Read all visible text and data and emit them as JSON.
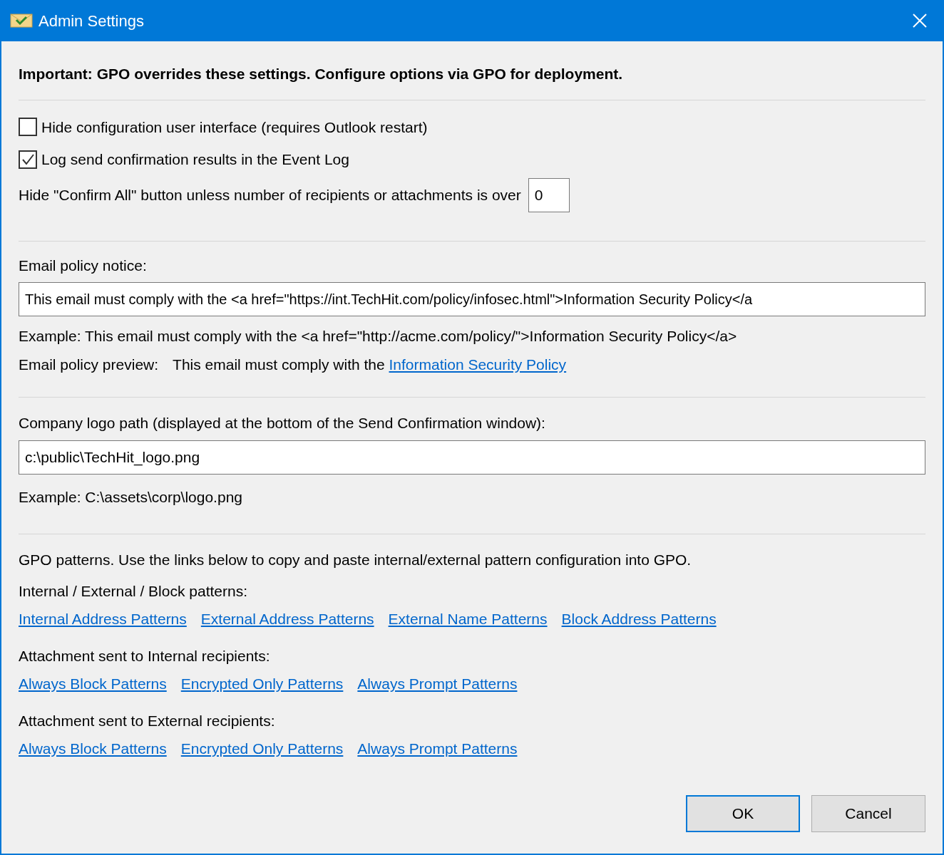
{
  "window": {
    "title": "Admin Settings"
  },
  "notice": "Important: GPO overrides these settings. Configure options via GPO for deployment.",
  "checkboxes": [
    {
      "label": "Hide configuration user interface (requires Outlook restart)",
      "checked": false
    },
    {
      "label": "Log send confirmation results in the Event Log",
      "checked": true
    }
  ],
  "confirm_all": {
    "label": "Hide \"Confirm All\" button unless number of recipients or attachments is over",
    "value": "0"
  },
  "policy": {
    "label": "Email policy notice:",
    "value": "This email must comply with the <a href=\"https://int.TechHit.com/policy/infosec.html\">Information Security Policy</a",
    "example": "Example: This email must comply with the <a href=\"http://acme.com/policy/\">Information Security Policy</a>",
    "preview_label": "Email policy preview:",
    "preview_text": "This email must comply with the",
    "preview_link": "Information Security Policy"
  },
  "logo": {
    "label": "Company logo path (displayed at the bottom of the Send Confirmation window):",
    "value": "c:\\public\\TechHit_logo.png",
    "example": "Example: C:\\assets\\corp\\logo.png"
  },
  "gpo": {
    "intro": "GPO patterns. Use the links below to copy and paste internal/external pattern configuration into GPO.",
    "groups": [
      {
        "label": "Internal / External / Block patterns:",
        "links": [
          "Internal Address Patterns",
          "External Address Patterns",
          "External Name Patterns",
          "Block Address Patterns"
        ]
      },
      {
        "label": "Attachment sent to Internal recipients:",
        "links": [
          "Always Block Patterns",
          "Encrypted Only Patterns",
          "Always Prompt Patterns"
        ]
      },
      {
        "label": "Attachment sent to External recipients:",
        "links": [
          "Always Block Patterns",
          "Encrypted Only Patterns",
          "Always Prompt Patterns"
        ]
      }
    ]
  },
  "buttons": [
    {
      "label": "OK",
      "default": true
    },
    {
      "label": "Cancel",
      "default": false
    }
  ]
}
